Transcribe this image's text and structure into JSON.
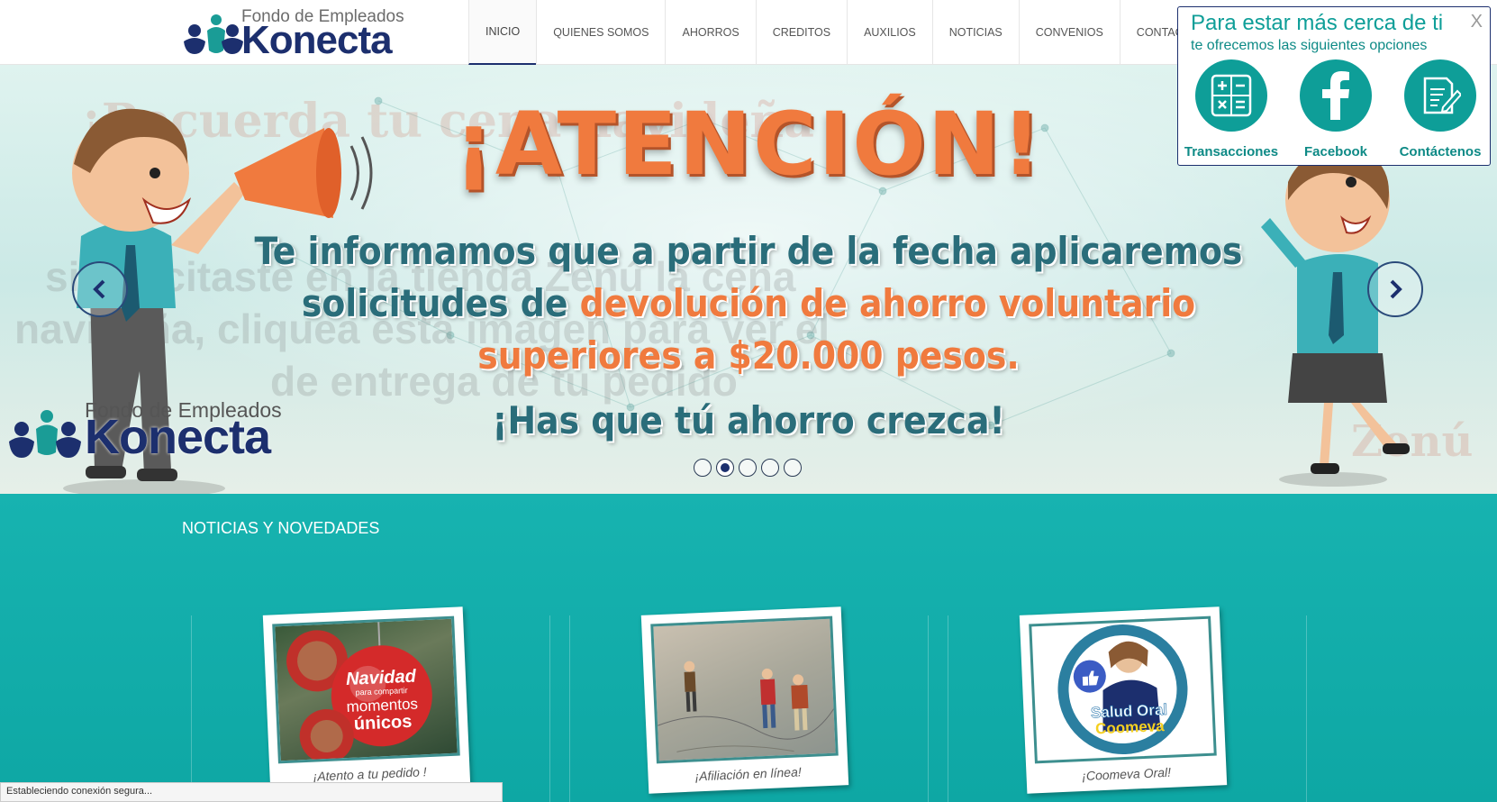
{
  "header": {
    "logo_top": "Fondo de Empleados",
    "logo_brand": "Konecta",
    "nav": [
      {
        "label": "INICIO",
        "active": true
      },
      {
        "label": "QUIENES SOMOS"
      },
      {
        "label": "AHORROS"
      },
      {
        "label": "CREDITOS"
      },
      {
        "label": "AUXILIOS"
      },
      {
        "label": "NOTICIAS"
      },
      {
        "label": "CONVENIOS"
      },
      {
        "label": "CONTACTENOS"
      }
    ]
  },
  "hero": {
    "headline": "¡ATENCIÓN!",
    "line1": "Te informamos que a partir de la fecha aplicaremos",
    "line2_a": "solicitudes de ",
    "line2_b": "devolución de ahorro voluntario",
    "line3": "superiores a $20.000 pesos.",
    "line4": "¡Has que tú ahorro crezca!",
    "ghost_text_1": "¡Recuerda tu cena navideña",
    "ghost_text_2": "si solicitaste en la tienda Zenú la cena",
    "ghost_text_3": "navideña, cliquea esta imagen para ver el",
    "ghost_text_4": "de entrega de tu pedido",
    "ghost_brand": "Zenú",
    "logo_top": "Fondo de Empleados",
    "logo_brand": "Konecta",
    "slides": 5,
    "active_slide": 2,
    "colors": {
      "orange": "#f07a3e",
      "teal_text": "#2a6d7a",
      "navy": "#1c2f6e"
    }
  },
  "popup": {
    "title": "Para estar más cerca de ti",
    "subtitle": "te ofrecemos las siguientes opciones",
    "close": "X",
    "options": [
      {
        "label": "Transacciones",
        "icon": "calculator-icon"
      },
      {
        "label": "Facebook",
        "icon": "facebook-icon"
      },
      {
        "label": "Contáctenos",
        "icon": "edit-document-icon"
      }
    ],
    "accent": "#0e9e98"
  },
  "news": {
    "title": "NOTICIAS Y NOVEDADES",
    "cards": [
      {
        "caption": "¡Atento a tu pedido !",
        "image": "christmas-ornaments",
        "badge_1": "Navidad",
        "badge_2": "para compartir",
        "badge_3": "momentos",
        "badge_4": "únicos"
      },
      {
        "caption": "¡Afiliación en línea!",
        "image": "travelers-on-map"
      },
      {
        "caption": "¡Coomeva Oral!",
        "image": "coomeva-smile",
        "badge_1": "Salud Oral",
        "badge_2": "Coomeva"
      }
    ],
    "background": "#12adaa"
  },
  "status_bar": "Estableciendo conexión segura..."
}
